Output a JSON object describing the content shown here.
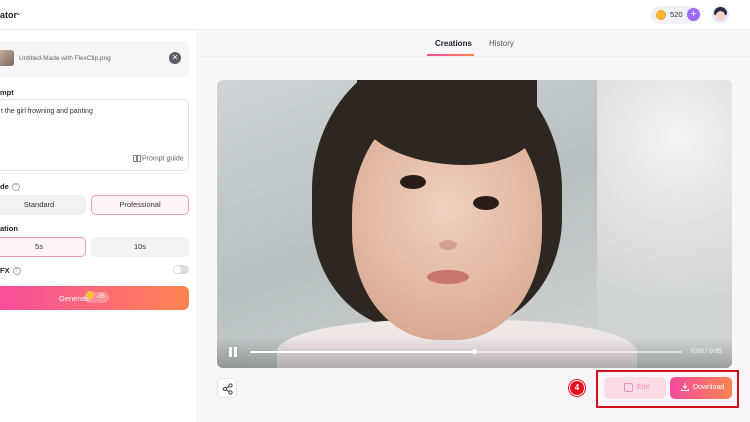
{
  "header": {
    "app_title": "ator",
    "credits": "520",
    "plus": "+"
  },
  "left": {
    "file_name": "Untitled-Made with FlexClip.png",
    "prompt_label": "mpt",
    "prompt_text": "t the girl frowning and panting",
    "prompt_guide": "Prompt guide",
    "mode_label": "de",
    "mode_options": [
      "Standard",
      "Professional"
    ],
    "mode_selected": "Professional",
    "duration_label": "ation",
    "duration_options": [
      "5s",
      "10s"
    ],
    "duration_selected": "5s",
    "sfx_label": "FX",
    "generate_label": "Generate",
    "generate_cost": "-35"
  },
  "right": {
    "tabs": [
      "Creations",
      "History"
    ],
    "active_tab": "Creations",
    "video": {
      "time": "0:03 / 0:05",
      "progress": 0.52
    },
    "step_badge": "4",
    "edit_label": "Edit",
    "download_label": "Download"
  },
  "colors": {
    "accent_pink": "#f74ba1",
    "accent_orange": "#ff8450",
    "highlight_red": "#d0101c"
  }
}
